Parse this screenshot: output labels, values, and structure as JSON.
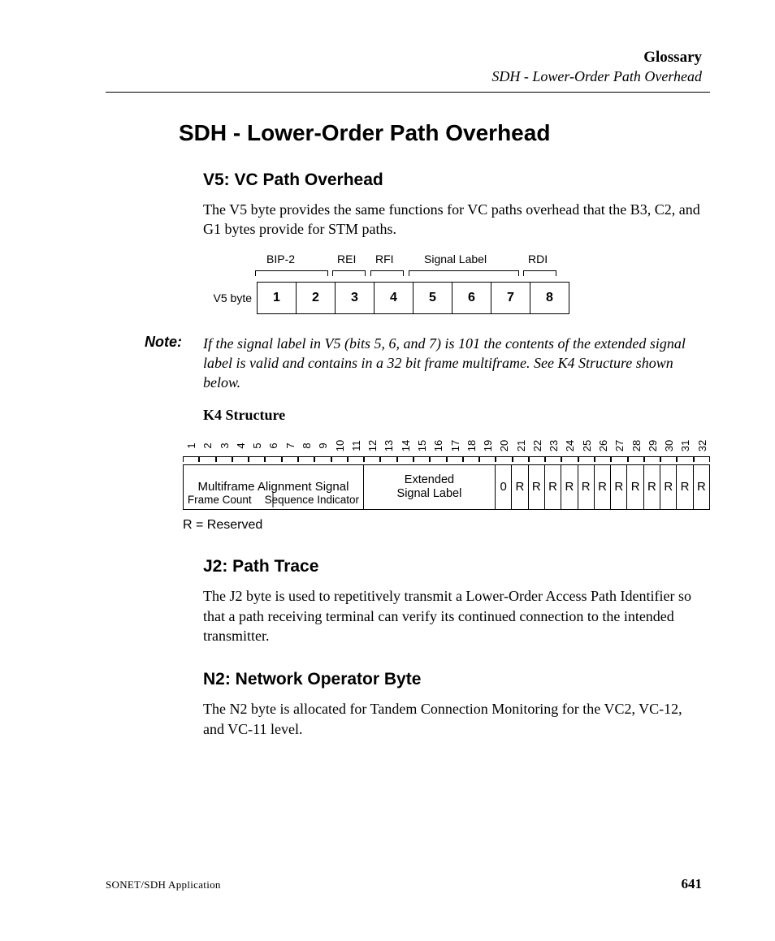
{
  "header": {
    "section": "Glossary",
    "subsection": "SDH - Lower-Order Path Overhead"
  },
  "h1": "SDH - Lower-Order Path Overhead",
  "v5": {
    "heading": "V5: VC Path Overhead",
    "para": "The V5 byte provides the same functions for VC paths overhead that the B3, C2, and G1 bytes provide for STM paths.",
    "labels": {
      "bip2": "BIP-2",
      "rei": "REI",
      "rfi": "RFI",
      "signal_label": "Signal Label",
      "rdi": "RDI"
    },
    "caption": "V5 byte",
    "cells": [
      "1",
      "2",
      "3",
      "4",
      "5",
      "6",
      "7",
      "8"
    ]
  },
  "note": {
    "label": "Note:",
    "text": "If the signal label in V5 (bits 5, 6, and 7) is 101 the contents of the extended signal label is valid and contains in a 32 bit frame multiframe. See K4 Structure shown below."
  },
  "k4": {
    "heading": "K4 Structure",
    "numbers": [
      "1",
      "2",
      "3",
      "4",
      "5",
      "6",
      "7",
      "8",
      "9",
      "10",
      "11",
      "12",
      "13",
      "14",
      "15",
      "16",
      "17",
      "18",
      "19",
      "20",
      "21",
      "22",
      "23",
      "24",
      "25",
      "26",
      "27",
      "28",
      "29",
      "30",
      "31",
      "32"
    ],
    "mas_top": "Multiframe Alignment Signal",
    "mas_left": "Frame Count",
    "mas_right": "Sequence Indicator",
    "esl_top": "Extended",
    "esl_bottom": "Signal Label",
    "zero": "0",
    "reserved": [
      "R",
      "R",
      "R",
      "R",
      "R",
      "R",
      "R",
      "R",
      "R",
      "R",
      "R",
      "R"
    ],
    "legend": "R = Reserved"
  },
  "j2": {
    "heading": "J2: Path Trace",
    "para": "The J2 byte is used to repetitively transmit a Lower-Order Access Path Identifier so that a path receiving terminal can verify its continued connection to the intended transmitter."
  },
  "n2": {
    "heading": "N2: Network Operator Byte",
    "para": "The N2 byte is allocated for Tandem Connection Monitoring for the VC2, VC-12, and VC-11 level."
  },
  "footer": {
    "app": "SONET/SDH Application",
    "page": "641"
  }
}
